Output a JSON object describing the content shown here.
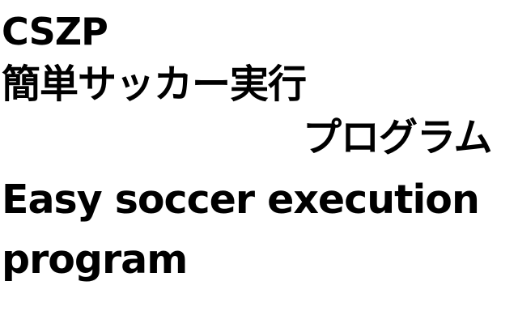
{
  "title": {
    "code": "CSZP",
    "japanese_line1": "簡単サッカー実行",
    "japanese_line2": "プログラム",
    "english_line1": "Easy soccer execution",
    "english_line2": "program"
  },
  "colors": {
    "background": "#ffffff",
    "text": "#000000"
  }
}
